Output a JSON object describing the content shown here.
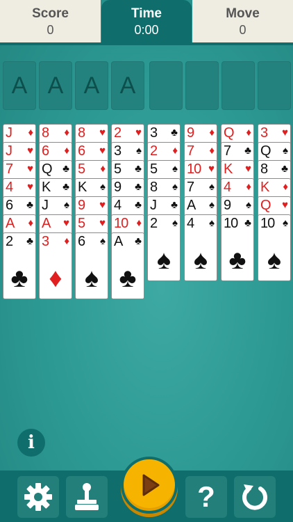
{
  "header": {
    "score_label": "Score",
    "score_value": "0",
    "time_label": "Time",
    "time_value": "0:00",
    "move_label": "Move",
    "move_value": "0"
  },
  "foundations": [
    "A",
    "A",
    "A",
    "A"
  ],
  "free_cells_count": 4,
  "columns": [
    [
      {
        "r": "J",
        "s": "♦"
      },
      {
        "r": "J",
        "s": "♥"
      },
      {
        "r": "7",
        "s": "♥"
      },
      {
        "r": "4",
        "s": "♥"
      },
      {
        "r": "6",
        "s": "♣"
      },
      {
        "r": "A",
        "s": "♦"
      },
      {
        "r": "2",
        "s": "♣"
      }
    ],
    [
      {
        "r": "8",
        "s": "♦"
      },
      {
        "r": "6",
        "s": "♦"
      },
      {
        "r": "Q",
        "s": "♣"
      },
      {
        "r": "K",
        "s": "♣"
      },
      {
        "r": "J",
        "s": "♠"
      },
      {
        "r": "A",
        "s": "♥"
      },
      {
        "r": "3",
        "s": "♦"
      }
    ],
    [
      {
        "r": "8",
        "s": "♥"
      },
      {
        "r": "6",
        "s": "♥"
      },
      {
        "r": "5",
        "s": "♦"
      },
      {
        "r": "K",
        "s": "♠"
      },
      {
        "r": "9",
        "s": "♥"
      },
      {
        "r": "5",
        "s": "♥"
      },
      {
        "r": "6",
        "s": "♠"
      }
    ],
    [
      {
        "r": "2",
        "s": "♥"
      },
      {
        "r": "3",
        "s": "♠"
      },
      {
        "r": "5",
        "s": "♣"
      },
      {
        "r": "9",
        "s": "♣"
      },
      {
        "r": "4",
        "s": "♣"
      },
      {
        "r": "10",
        "s": "♦"
      },
      {
        "r": "A",
        "s": "♣"
      }
    ],
    [
      {
        "r": "3",
        "s": "♣"
      },
      {
        "r": "2",
        "s": "♦"
      },
      {
        "r": "5",
        "s": "♠"
      },
      {
        "r": "8",
        "s": "♠"
      },
      {
        "r": "J",
        "s": "♣"
      },
      {
        "r": "2",
        "s": "♠"
      }
    ],
    [
      {
        "r": "9",
        "s": "♦"
      },
      {
        "r": "7",
        "s": "♦"
      },
      {
        "r": "10",
        "s": "♥"
      },
      {
        "r": "7",
        "s": "♠"
      },
      {
        "r": "A",
        "s": "♠"
      },
      {
        "r": "4",
        "s": "♠"
      }
    ],
    [
      {
        "r": "Q",
        "s": "♦"
      },
      {
        "r": "7",
        "s": "♣"
      },
      {
        "r": "K",
        "s": "♥"
      },
      {
        "r": "4",
        "s": "♦"
      },
      {
        "r": "9",
        "s": "♠"
      },
      {
        "r": "10",
        "s": "♣"
      }
    ],
    [
      {
        "r": "3",
        "s": "♥"
      },
      {
        "r": "Q",
        "s": "♠"
      },
      {
        "r": "8",
        "s": "♣"
      },
      {
        "r": "K",
        "s": "♦"
      },
      {
        "r": "Q",
        "s": "♥"
      },
      {
        "r": "10",
        "s": "♠"
      }
    ]
  ],
  "buttons": {
    "info_icon": "info-icon",
    "settings_icon": "gear-icon",
    "hint_icon": "joystick-icon",
    "play_icon": "play-icon",
    "help_icon": "question-icon",
    "undo_icon": "undo-icon",
    "info_glyph": "i",
    "help_glyph": "?"
  },
  "colors": {
    "felt": "#2c9892",
    "bar": "#0f6e6b",
    "play": "#f6b400",
    "red_suit": "#e02020",
    "black_suit": "#111111"
  }
}
